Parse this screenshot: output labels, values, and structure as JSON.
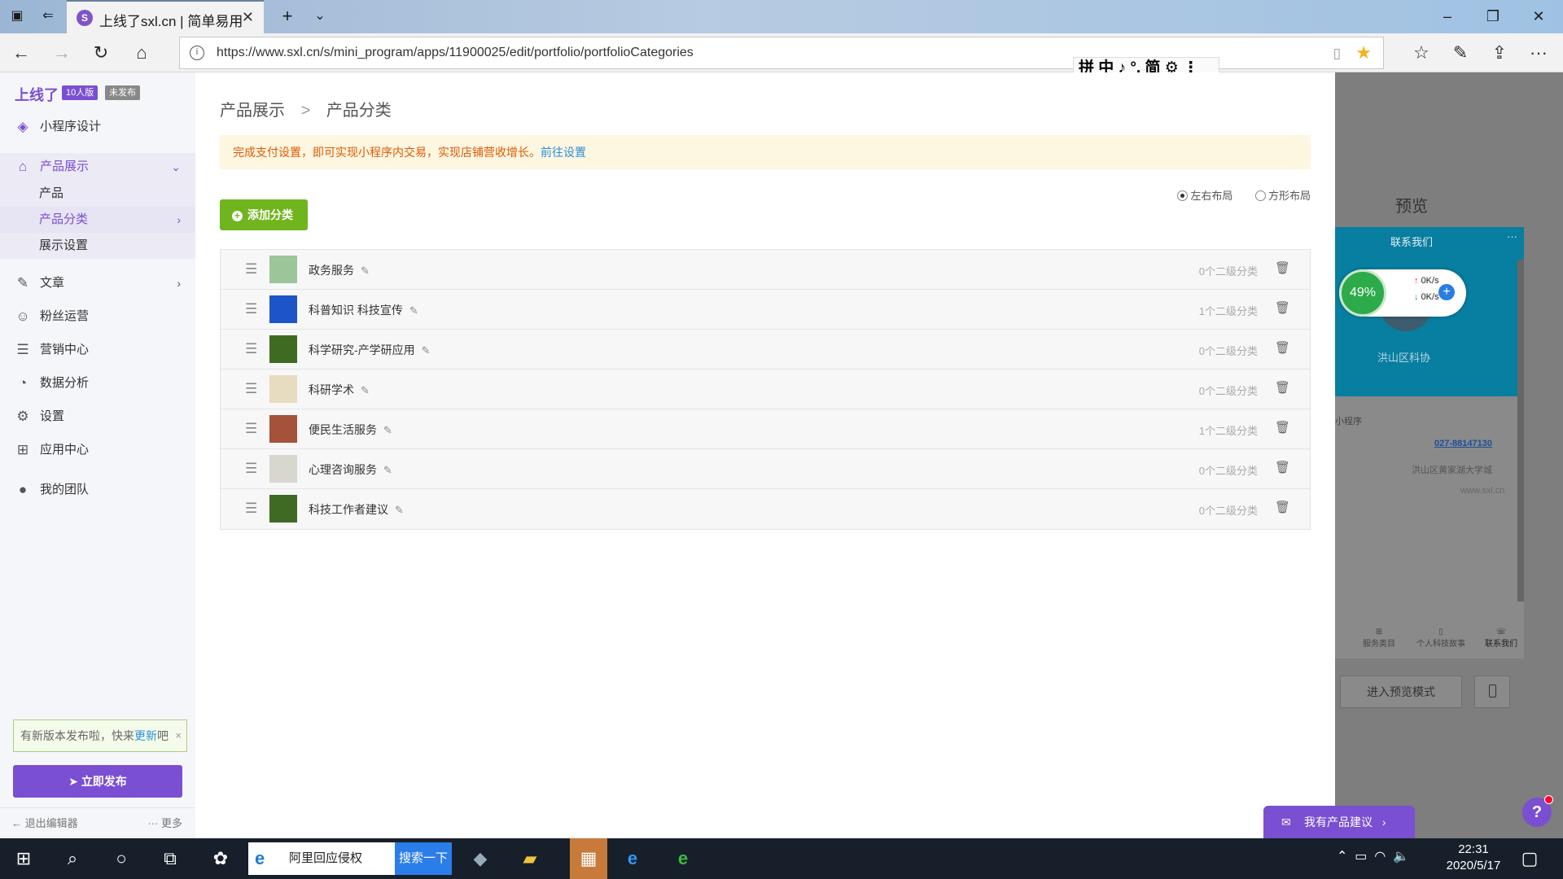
{
  "browser": {
    "tab_title": "上线了sxl.cn | 简单易用",
    "tab_favicon": "S",
    "url": "https://www.sxl.cn/s/mini_program/apps/11900025/edit/portfolio/portfolioCategories",
    "ime_toolbar": "拼 中 ♪ °, 简 ⚙ ⋮"
  },
  "sidebar": {
    "logo": "上线了",
    "badge_plan": "10人版",
    "badge_status": "未发布",
    "mini_design": "小程序设计",
    "product_display": "产品展示",
    "sub_items": [
      "产品",
      "产品分类",
      "展示设置"
    ],
    "items": [
      "文章",
      "粉丝运营",
      "营销中心",
      "数据分析",
      "设置",
      "应用中心",
      "我的团队"
    ],
    "tip_text": "有新版本发布啦，快来",
    "tip_link": "更新",
    "tip_suffix": "吧",
    "tip_close": "×",
    "publish_label": "立即发布",
    "exit_label": "退出编辑器",
    "more_label": "··· 更多"
  },
  "main": {
    "crumb_parent": "产品展示",
    "crumb_sep": ">",
    "crumb_current": "产品分类",
    "notice_text": "完成支付设置，即可实现小程序内交易，实现店铺营收增长。",
    "notice_link": "前往设置",
    "layout_lr": "左右布局",
    "layout_grid": "方形布局",
    "add_label": "添加分类",
    "categories": [
      {
        "name": "政务服务",
        "count": "0个二级分类",
        "thumb": "#9cc59a"
      },
      {
        "name": "科普知识 科技宣传",
        "count": "1个二级分类",
        "thumb": "#1d55c9"
      },
      {
        "name": "科学研究-产学研应用",
        "count": "0个二级分类",
        "thumb": "#3f6a22"
      },
      {
        "name": "科研学术",
        "count": "0个二级分类",
        "thumb": "#e8dcc0"
      },
      {
        "name": "便民生活服务",
        "count": "1个二级分类",
        "thumb": "#a5523a"
      },
      {
        "name": "心理咨询服务",
        "count": "0个二级分类",
        "thumb": "#d7d7d0"
      },
      {
        "name": "科技工作者建议",
        "count": "0个二级分类",
        "thumb": "#3e6a24"
      }
    ]
  },
  "preview": {
    "title": "预览",
    "header_title": "联系我们",
    "org_name": "洪山区科协",
    "mini_label": "小程序",
    "phone": "027-88147130",
    "address": "洪山区黄家湖大学城",
    "website": "www.sxl.cn",
    "net_percent": "49%",
    "net_up": "0K/s",
    "net_down": "0K/s",
    "tabs": [
      "服务类目",
      "个人科技故事",
      "联系我们"
    ],
    "enter_preview": "进入预览模式",
    "suggest": "我有产品建议",
    "help": "?"
  },
  "taskbar": {
    "search_text": "阿里回应侵权",
    "search_btn": "搜索一下",
    "time": "22:31",
    "date": "2020/5/17"
  }
}
